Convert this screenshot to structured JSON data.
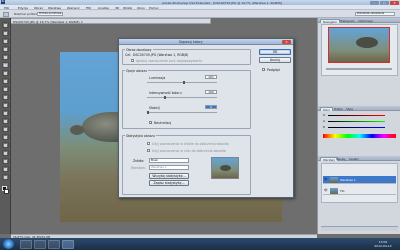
{
  "window": {
    "app_icon": "Ps",
    "title": "Adobe Photoshop CS4 Extended - [DSC00745.JPG @ 16,7% (Warstwa 1, RGB/8)]",
    "minimize": "–",
    "maximize": "□",
    "close": "✕"
  },
  "menu": [
    "Plik",
    "Edycja",
    "Obraz",
    "Warstwa",
    "Zaznacz",
    "Filtr",
    "Analiza",
    "3D",
    "Widok",
    "Okno",
    "Pomoc"
  ],
  "options_bar": {
    "sample_label": "Rozmiar próbki:",
    "sample_value": "Próbka punktowa",
    "workspace": "Pozostałe ustawienia"
  },
  "document_tab": {
    "label": "DSC00745.JPG @ 16,7% (Warstwa 1, RGB/8) ×"
  },
  "dialog": {
    "title": "Dopasuj kolory",
    "close": "✕",
    "target_group": "Obraz docelowy",
    "target_label": "Cel:",
    "target_value": "DSC00745.JPG (Warstwa 1, RGB/8)",
    "ignore_selection": "Ignoruj zaznaczenie przy dopasowywaniu",
    "image_options_group": "Opcje obrazu",
    "luminance_label": "Luminacja",
    "luminance_value": "101",
    "color_intensity_label": "Intensywność koloru",
    "color_intensity_value": "100",
    "fade_label": "Słabnij",
    "fade_value": "0",
    "neutralize_label": "Neutralizuj",
    "image_stats_group": "Statystyka obrazu",
    "use_selection_source": "Użyj zaznaczenia w źródle do obliczenia kolorów",
    "use_selection_target": "Użyj zaznaczenia w celu do obliczenia kolorów",
    "source_label": "Źródło:",
    "source_value": "Brak",
    "layer_label": "Warstwa:",
    "layer_value": "Warstwa 1",
    "load_stats": "Wczytaj statystykę...",
    "save_stats": "Zapisz statystykę...",
    "ok": "OK",
    "cancel": "Anuluj",
    "preview": "Podgląd",
    "check": "✓"
  },
  "right_panel": {
    "navigator_tabs": [
      "Nawigator",
      "Histogram",
      "Informacje"
    ],
    "color_tabs": [
      "Kolor",
      "Próbki",
      "Style"
    ],
    "slider_labels": [
      "R",
      "G",
      "B"
    ],
    "layers_tabs": [
      "Warstwy",
      "Kanały",
      "Ścieżki"
    ],
    "layers": [
      {
        "name": "Warstwa 1",
        "eye": "👁"
      },
      {
        "name": "Tło",
        "eye": "👁"
      }
    ]
  },
  "status_bar": {
    "text": "16,67%   Dok: 34,3M/34,3M"
  },
  "taskbar": {
    "time": "13:02",
    "date": "2012-04-12"
  },
  "colors": {
    "accent": "#3a74c8",
    "dialog_bg": "#dfe4ea",
    "workspace_bg": "#6e6e6e"
  }
}
